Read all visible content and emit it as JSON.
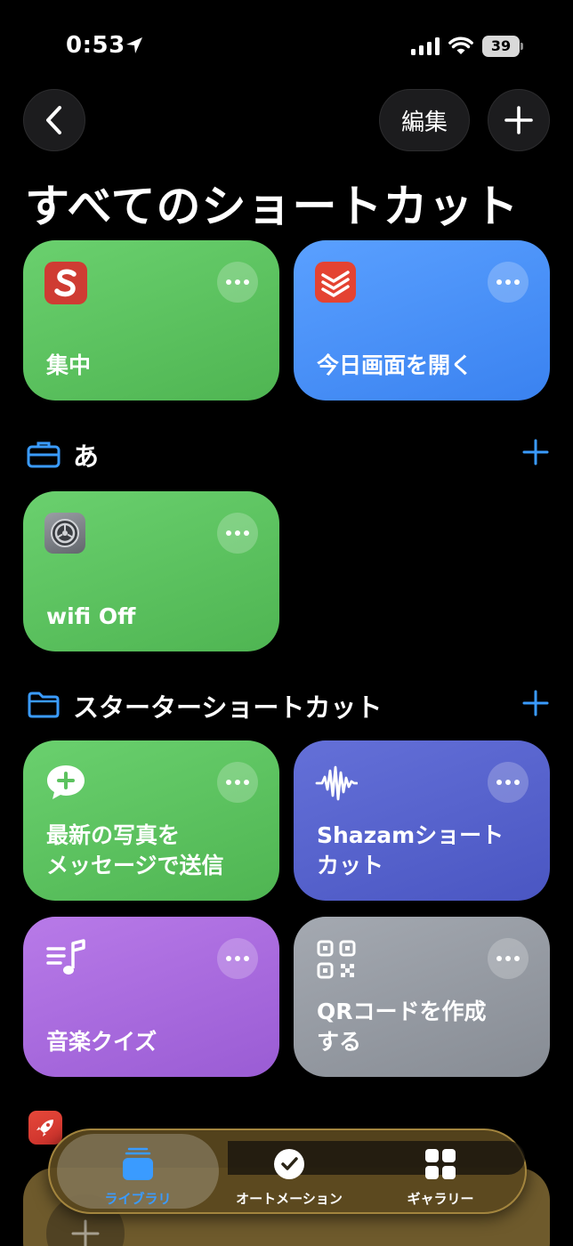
{
  "status_bar": {
    "time": "0:53",
    "battery": "39"
  },
  "nav": {
    "edit_label": "編集"
  },
  "page_title": "すべてのショートカット",
  "top_tiles": [
    {
      "label": "集中",
      "color": "#5cc25f",
      "icon": "s-app-icon"
    },
    {
      "label": "今日画面を開く",
      "color": "#4a92fa",
      "icon": "todoist-icon"
    }
  ],
  "section_a": {
    "title": "あ",
    "tiles": [
      {
        "label": "wifi Off",
        "color": "#5cc25f",
        "icon": "settings-icon"
      }
    ]
  },
  "section_starter": {
    "title": "スターターショートカット",
    "tiles": [
      {
        "label": "最新の写真を\nメッセージで送信",
        "color": "#5cc25f",
        "icon": "message-plus-icon"
      },
      {
        "label": "Shazamショート\nカット",
        "color": "#5660cc",
        "icon": "waveform-icon"
      },
      {
        "label": "音楽クイズ",
        "color": "#a86be0",
        "icon": "music-list-icon"
      },
      {
        "label": "QRコードを作成\nする",
        "color": "#959aa2",
        "icon": "qr-code-icon"
      }
    ]
  },
  "tab_bar": {
    "tabs": [
      {
        "label": "ライブラリ",
        "icon": "library-icon",
        "active": true
      },
      {
        "label": "オートメーション",
        "icon": "clock-check-icon",
        "active": false
      },
      {
        "label": "ギャラリー",
        "icon": "grid-icon",
        "active": false
      }
    ]
  },
  "colors": {
    "accent": "#3a9bff",
    "background": "#000000"
  }
}
